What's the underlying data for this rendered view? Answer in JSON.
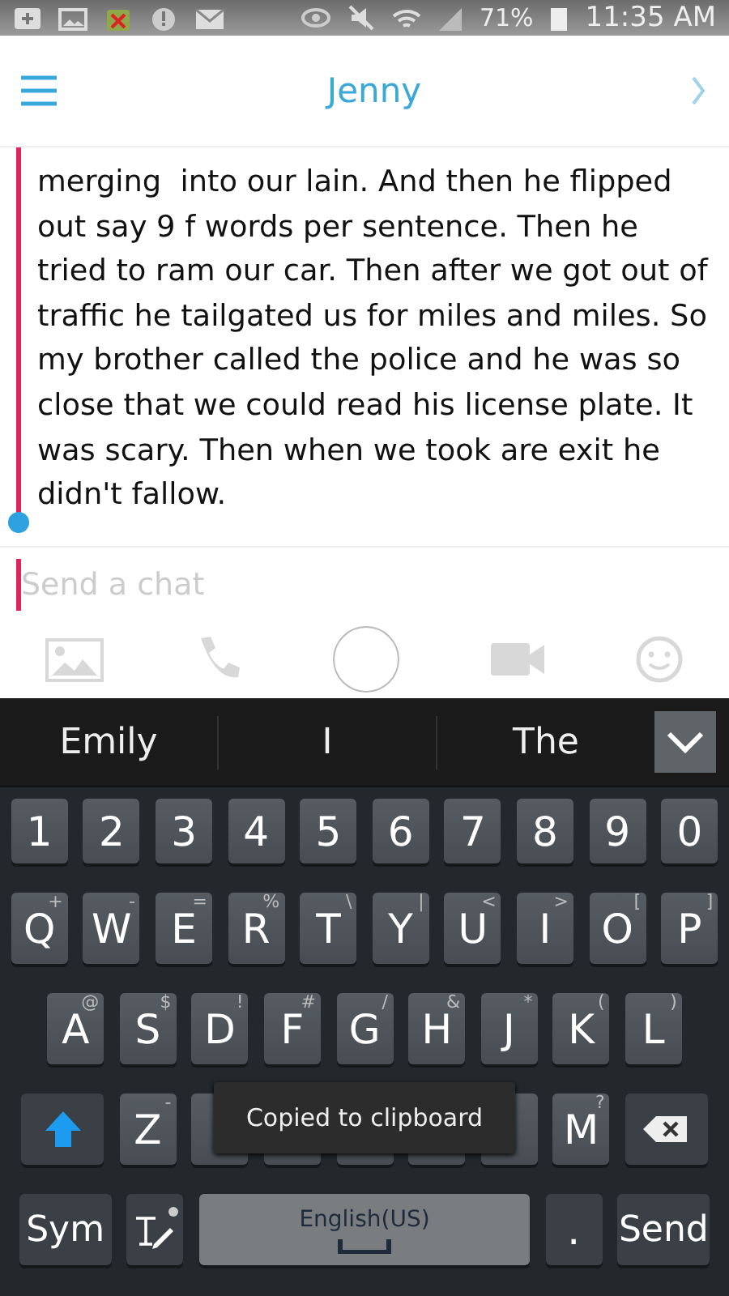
{
  "status_bar": {
    "battery": "71%",
    "time": "11:35 AM"
  },
  "header": {
    "title": "Jenny"
  },
  "message": {
    "text": "merging  into our lain. And then he flipped out say 9 f words per sentence. Then he tried to ram our car. Then after we got out of traffic he tailgated us for miles and miles. So my brother called the police and he was so close that we could read his license plate. It was scary. Then when we took are exit he didn't fallow."
  },
  "chat_input": {
    "placeholder": "Send a chat"
  },
  "suggestions": [
    {
      "label": "Emily"
    },
    {
      "label": "I"
    },
    {
      "label": "The"
    }
  ],
  "keyboard": {
    "rows": [
      {
        "keys": [
          {
            "kind": "char",
            "label": "1"
          },
          {
            "kind": "char",
            "label": "2"
          },
          {
            "kind": "char",
            "label": "3"
          },
          {
            "kind": "char",
            "label": "4"
          },
          {
            "kind": "char",
            "label": "5"
          },
          {
            "kind": "char",
            "label": "6"
          },
          {
            "kind": "char",
            "label": "7"
          },
          {
            "kind": "char",
            "label": "8"
          },
          {
            "kind": "char",
            "label": "9"
          },
          {
            "kind": "char",
            "label": "0"
          }
        ]
      },
      {
        "keys": [
          {
            "kind": "char",
            "label": "Q",
            "hint": "+"
          },
          {
            "kind": "char",
            "label": "W",
            "hint": "-"
          },
          {
            "kind": "char",
            "label": "E",
            "hint": "="
          },
          {
            "kind": "char",
            "label": "R",
            "hint": "%"
          },
          {
            "kind": "char",
            "label": "T",
            "hint": "\\"
          },
          {
            "kind": "char",
            "label": "Y",
            "hint": "|"
          },
          {
            "kind": "char",
            "label": "U",
            "hint": "<"
          },
          {
            "kind": "char",
            "label": "I",
            "hint": ">"
          },
          {
            "kind": "char",
            "label": "O",
            "hint": "["
          },
          {
            "kind": "char",
            "label": "P",
            "hint": "]"
          }
        ]
      },
      {
        "keys": [
          {
            "kind": "char",
            "label": "A",
            "hint": "@"
          },
          {
            "kind": "char",
            "label": "S",
            "hint": "$"
          },
          {
            "kind": "char",
            "label": "D",
            "hint": "!"
          },
          {
            "kind": "char",
            "label": "F",
            "hint": "#"
          },
          {
            "kind": "char",
            "label": "G",
            "hint": "/"
          },
          {
            "kind": "char",
            "label": "H",
            "hint": "&"
          },
          {
            "kind": "char",
            "label": "J",
            "hint": "*"
          },
          {
            "kind": "char",
            "label": "K",
            "hint": "("
          },
          {
            "kind": "char",
            "label": "L",
            "hint": ")"
          }
        ]
      },
      {
        "keys": [
          {
            "kind": "shift"
          },
          {
            "kind": "char",
            "label": "Z",
            "hint": "-"
          },
          {
            "kind": "covered"
          },
          {
            "kind": "covered"
          },
          {
            "kind": "covered"
          },
          {
            "kind": "covered"
          },
          {
            "kind": "covered"
          },
          {
            "kind": "char",
            "label": "M",
            "hint": "?"
          },
          {
            "kind": "backspace"
          }
        ]
      },
      {
        "keys": [
          {
            "kind": "wide",
            "label": "Sym"
          },
          {
            "kind": "tool"
          },
          {
            "kind": "space",
            "label": "English(US)"
          },
          {
            "kind": "char",
            "label": "."
          },
          {
            "kind": "wide",
            "label": "Send"
          }
        ]
      }
    ]
  },
  "toast": {
    "text": "Copied to clipboard"
  }
}
